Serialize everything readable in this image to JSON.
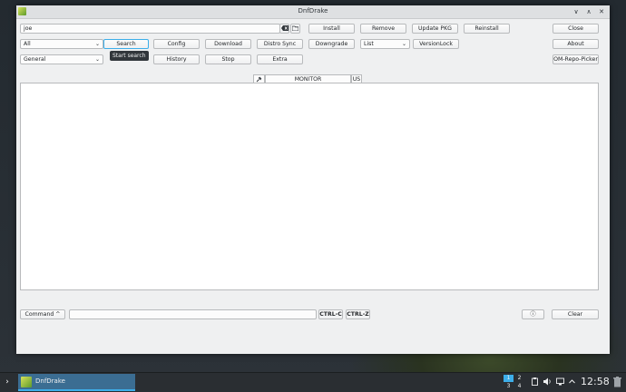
{
  "window": {
    "title": "DnfDrake",
    "minimize_glyph": "∨",
    "maximize_glyph": "∧",
    "close_glyph": "✕"
  },
  "search": {
    "value": "joe"
  },
  "row1": {
    "install": "Install",
    "remove": "Remove",
    "update_pkg": "Update PKG",
    "reinstall": "Reinstall",
    "close": "Close"
  },
  "row2": {
    "filter_selected": "All",
    "search": "Search",
    "config": "Config",
    "download": "Download",
    "distro_sync": "Distro Sync",
    "downgrade": "Downgrade",
    "list_selected": "List",
    "versionlock": "VersionLock",
    "about": "About"
  },
  "row3": {
    "group_selected": "General",
    "history": "History",
    "stop": "Stop",
    "extra": "Extra",
    "om_repo_picker": "OM-Repo-Picker"
  },
  "tooltip": {
    "text": "Start search"
  },
  "monitor": {
    "label": "MONITOR",
    "lang": "US"
  },
  "bottom": {
    "command": "Command ^",
    "ctrl_c": "CTRL-C",
    "ctrl_z": "CTRL-Z",
    "info_glyph": "ⓘ",
    "clear": "Clear"
  },
  "taskbar": {
    "app_label": "DnfDrake",
    "pager": [
      "1",
      "2",
      "3",
      "4"
    ],
    "clock": "12:58"
  },
  "colors": {
    "accent": "#3daee9",
    "taskbar": "#2a2e32",
    "window_bg": "#eff0f1"
  }
}
